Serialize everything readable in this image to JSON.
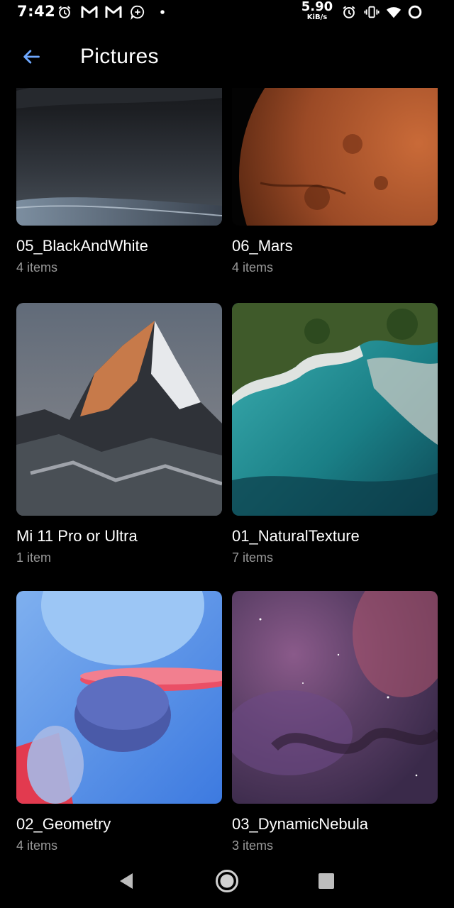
{
  "status_bar": {
    "time": "7:42",
    "net_speed_value": "5.90",
    "net_speed_unit": "KiB/s",
    "left_icons": [
      "alarm-icon",
      "gmail-icon",
      "gmail-icon",
      "add-circle-icon",
      "dot-icon"
    ],
    "right_icons": [
      "alarm-icon",
      "vibrate-icon",
      "wifi-icon",
      "battery-ring-icon"
    ]
  },
  "app_bar": {
    "title": "Pictures",
    "back_icon": "arrow-back-icon",
    "accent_color": "#6ea8ff"
  },
  "albums": [
    {
      "name": "05_BlackAndWhite",
      "count": "4 items"
    },
    {
      "name": "06_Mars",
      "count": "4 items"
    },
    {
      "name": "Mi 11 Pro or Ultra",
      "count": "1 item"
    },
    {
      "name": "01_NaturalTexture",
      "count": "7 items"
    },
    {
      "name": "02_Geometry",
      "count": "4 items"
    },
    {
      "name": "03_DynamicNebula",
      "count": "3 items"
    }
  ],
  "nav_bar": {
    "buttons": [
      "back-triangle-icon",
      "home-circle-icon",
      "recents-square-icon"
    ]
  }
}
